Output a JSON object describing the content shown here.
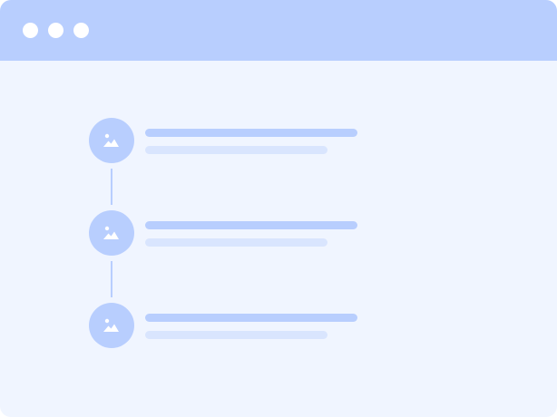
{
  "window": {
    "controls": [
      "window-dot-1",
      "window-dot-2",
      "window-dot-3"
    ]
  },
  "list": {
    "items": [
      {
        "icon": "image-icon"
      },
      {
        "icon": "image-icon"
      },
      {
        "icon": "image-icon"
      }
    ]
  },
  "colors": {
    "titlebar": "#B8CEFE",
    "background": "#F0F5FF",
    "accent": "#B8CEFE",
    "placeholder_light": "#D9E5FE",
    "dot": "#FFFFFF"
  }
}
